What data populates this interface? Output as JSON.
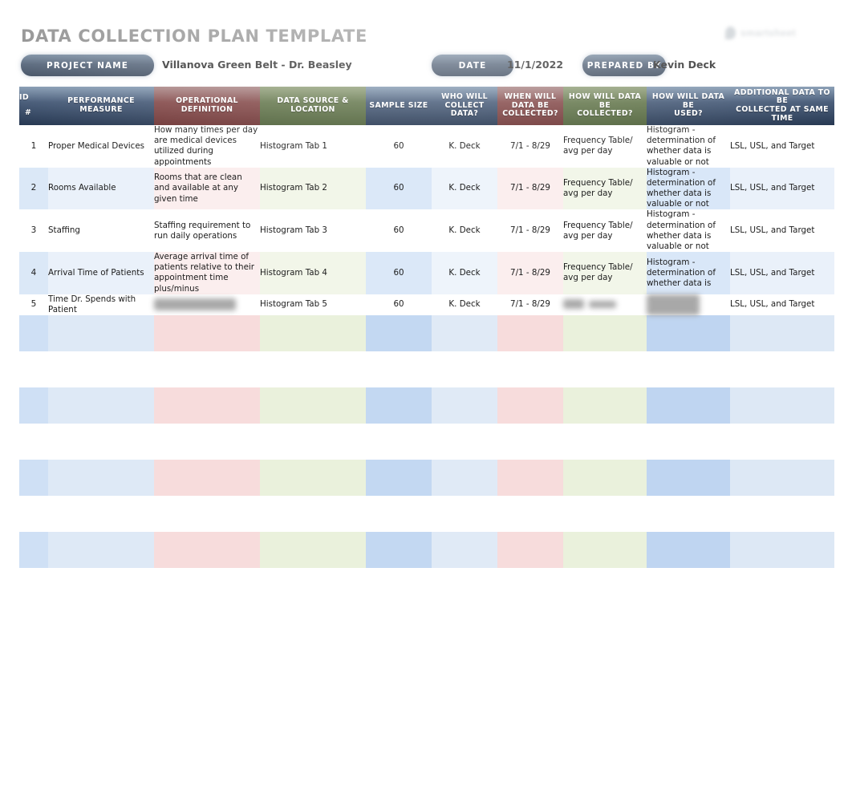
{
  "document": {
    "title": "DATA COLLECTION PLAN TEMPLATE"
  },
  "logo": {
    "text": "smartsheet",
    "mark": "droplet-icon"
  },
  "meta": {
    "project_label": "PROJECT NAME",
    "project_value": "Villanova Green Belt - Dr. Beasley",
    "date_label": "DATE",
    "date_value": "11/1/2022",
    "prepared_label": "PREPARED BY",
    "prepared_value": "Kevin Deck"
  },
  "colors": {
    "header_blue": "#22344e",
    "header_red": "#6a2f2f",
    "header_green": "#4a5d34",
    "title_gray": "#808080",
    "band_blue": "#cfe0f5",
    "band_red": "#f7dcdc",
    "band_green": "#eaf1dc"
  },
  "table": {
    "columns": [
      {
        "line1": "ID",
        "line2": "#",
        "tone": "blue"
      },
      {
        "line1": "PERFORMANCE MEASURE",
        "line2": "",
        "tone": "blue"
      },
      {
        "line1": "OPERATIONAL",
        "line2": "DEFINITION",
        "tone": "red"
      },
      {
        "line1": "DATA SOURCE &",
        "line2": "LOCATION",
        "tone": "green"
      },
      {
        "line1": "SAMPLE SIZE",
        "line2": "",
        "tone": "blue"
      },
      {
        "line1": "WHO WILL",
        "line2": "COLLECT DATA?",
        "tone": "blue"
      },
      {
        "line1": "WHEN WILL",
        "line2": "DATA BE",
        "line3": "COLLECTED?",
        "tone": "red"
      },
      {
        "line1": "HOW WILL DATA BE",
        "line2": "COLLECTED?",
        "tone": "green"
      },
      {
        "line1": "HOW WILL DATA BE",
        "line2": "USED?",
        "tone": "blue"
      },
      {
        "line1": "ADDITIONAL DATA TO BE",
        "line2": "COLLECTED AT SAME",
        "line3": "TIME",
        "tone": "blue"
      }
    ],
    "rows": [
      {
        "id": "1",
        "performance_measure": "Proper Medical Devices",
        "operational_definition": "How many times per day are medical devices utilized during appointments",
        "data_source": "Histogram Tab 1",
        "sample_size": "60",
        "who_collects": "K. Deck",
        "when_collected": "7/1 - 8/29",
        "how_collected": "Frequency Table/ avg per day",
        "how_used": "Histogram - determination of whether data is valuable or not",
        "additional_data": "LSL, USL, and Target",
        "redacted": []
      },
      {
        "id": "2",
        "performance_measure": "Rooms Available",
        "operational_definition": "Rooms that are clean and available at any given time",
        "data_source": "Histogram Tab 2",
        "sample_size": "60",
        "who_collects": "K. Deck",
        "when_collected": "7/1 - 8/29",
        "how_collected": "Frequency Table/ avg per day",
        "how_used": "Histogram - determination of whether data is valuable or not",
        "additional_data": "LSL, USL, and Target",
        "redacted": []
      },
      {
        "id": "3",
        "performance_measure": "Staffing",
        "operational_definition": "Staffing requirement to run daily operations",
        "data_source": "Histogram Tab 3",
        "sample_size": "60",
        "who_collects": "K. Deck",
        "when_collected": "7/1 - 8/29",
        "how_collected": "Frequency Table/ avg per day",
        "how_used": "Histogram - determination of whether data is valuable or not",
        "additional_data": "LSL, USL, and Target",
        "redacted": []
      },
      {
        "id": "4",
        "performance_measure": "Arrival Time of Patients",
        "operational_definition": "Average arrival time of patients relative to their appointment time plus/minus",
        "data_source": "Histogram Tab 4",
        "sample_size": "60",
        "who_collects": "K. Deck",
        "when_collected": "7/1 - 8/29",
        "how_collected": "Frequency Table/ avg per day",
        "how_used": "Histogram - determination of whether data is",
        "additional_data": "LSL, USL, and Target",
        "redacted": []
      },
      {
        "id": "5",
        "performance_measure": "Time Dr. Spends with Patient",
        "operational_definition": "",
        "data_source": "Histogram Tab 5",
        "sample_size": "60",
        "who_collects": "K. Deck",
        "when_collected": "7/1 - 8/29",
        "how_collected": "",
        "how_used": "",
        "additional_data": "LSL, USL, and Target",
        "redacted": [
          "operational_definition",
          "how_collected",
          "how_used"
        ]
      }
    ],
    "empty_row_count": 7
  }
}
